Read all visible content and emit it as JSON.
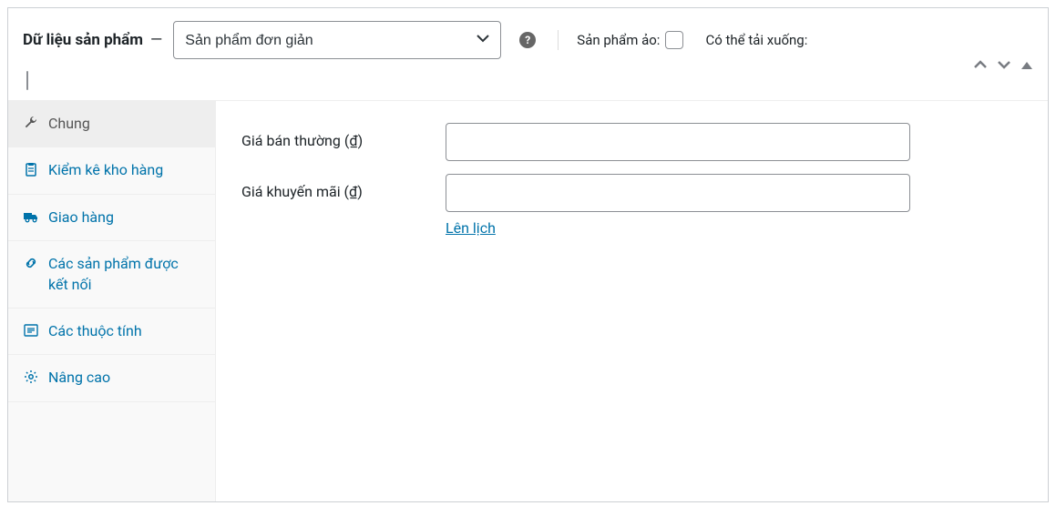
{
  "header": {
    "title": "Dữ liệu sản phẩm",
    "dash": "—",
    "product_type_selected": "Sản phẩm đơn giản",
    "virtual_label": "Sản phẩm ảo:",
    "downloadable_label": "Có thể tải xuống:"
  },
  "sidebar": {
    "items": [
      {
        "label": "Chung",
        "icon": "wrench-icon"
      },
      {
        "label": "Kiểm kê kho hàng",
        "icon": "clipboard-icon"
      },
      {
        "label": "Giao hàng",
        "icon": "truck-icon"
      },
      {
        "label": "Các sản phẩm được kết nối",
        "icon": "link-icon"
      },
      {
        "label": "Các thuộc tính",
        "icon": "list-icon"
      },
      {
        "label": "Nâng cao",
        "icon": "gear-icon"
      }
    ]
  },
  "content": {
    "regular_price_label": "Giá bán thường (₫)",
    "sale_price_label": "Giá khuyến mãi (₫)",
    "regular_price_value": "",
    "sale_price_value": "",
    "schedule_link": "Lên lịch"
  }
}
